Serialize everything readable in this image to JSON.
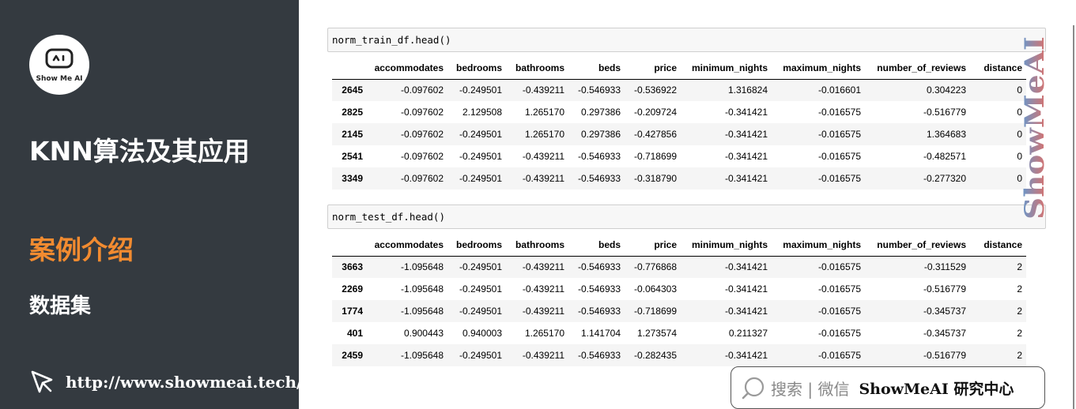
{
  "sidebar": {
    "logo_text": "Show Me AI",
    "course_title": "KNN算法及其应用",
    "section_title": "案例介绍",
    "sub_title": "数据集",
    "link_text": "http://www.showmeai.tech/"
  },
  "colors": {
    "sidebar_bg": "#343a40",
    "accent_orange": "#f28b30",
    "watermark_top": "#5b9bd5",
    "watermark_bottom": "#f06a5a"
  },
  "cells": [
    {
      "code": "norm_train_df.head()",
      "columns": [
        "",
        "accommodates",
        "bedrooms",
        "bathrooms",
        "beds",
        "price",
        "minimum_nights",
        "maximum_nights",
        "number_of_reviews",
        "distance"
      ],
      "rows": [
        {
          "index": "2645",
          "values": [
            "-0.097602",
            "-0.249501",
            "-0.439211",
            "-0.546933",
            "-0.536922",
            "1.316824",
            "-0.016601",
            "0.304223",
            "0"
          ]
        },
        {
          "index": "2825",
          "values": [
            "-0.097602",
            "2.129508",
            "1.265170",
            "0.297386",
            "-0.209724",
            "-0.341421",
            "-0.016575",
            "-0.516779",
            "0"
          ]
        },
        {
          "index": "2145",
          "values": [
            "-0.097602",
            "-0.249501",
            "1.265170",
            "0.297386",
            "-0.427856",
            "-0.341421",
            "-0.016575",
            "1.364683",
            "0"
          ]
        },
        {
          "index": "2541",
          "values": [
            "-0.097602",
            "-0.249501",
            "-0.439211",
            "-0.546933",
            "-0.718699",
            "-0.341421",
            "-0.016575",
            "-0.482571",
            "0"
          ]
        },
        {
          "index": "3349",
          "values": [
            "-0.097602",
            "-0.249501",
            "-0.439211",
            "-0.546933",
            "-0.318790",
            "-0.341421",
            "-0.016575",
            "-0.277320",
            "0"
          ]
        }
      ]
    },
    {
      "code": "norm_test_df.head()",
      "columns": [
        "",
        "accommodates",
        "bedrooms",
        "bathrooms",
        "beds",
        "price",
        "minimum_nights",
        "maximum_nights",
        "number_of_reviews",
        "distance"
      ],
      "rows": [
        {
          "index": "3663",
          "values": [
            "-1.095648",
            "-0.249501",
            "-0.439211",
            "-0.546933",
            "-0.776868",
            "-0.341421",
            "-0.016575",
            "-0.311529",
            "2"
          ]
        },
        {
          "index": "2269",
          "values": [
            "-1.095648",
            "-0.249501",
            "-0.439211",
            "-0.546933",
            "-0.064303",
            "-0.341421",
            "-0.016575",
            "-0.516779",
            "2"
          ]
        },
        {
          "index": "1774",
          "values": [
            "-1.095648",
            "-0.249501",
            "-0.439211",
            "-0.546933",
            "-0.718699",
            "-0.341421",
            "-0.016575",
            "-0.345737",
            "2"
          ]
        },
        {
          "index": "401",
          "values": [
            "0.900443",
            "0.940003",
            "1.265170",
            "1.141704",
            "1.273574",
            "0.211327",
            "-0.016575",
            "-0.345737",
            "2"
          ]
        },
        {
          "index": "2459",
          "values": [
            "-1.095648",
            "-0.249501",
            "-0.439211",
            "-0.546933",
            "-0.282435",
            "-0.341421",
            "-0.016575",
            "-0.516779",
            "2"
          ]
        }
      ]
    }
  ],
  "watermark": {
    "text": "ShowMeAI"
  },
  "badge": {
    "hint": "搜索 | 微信",
    "brand": "ShowMeAI 研究中心"
  }
}
